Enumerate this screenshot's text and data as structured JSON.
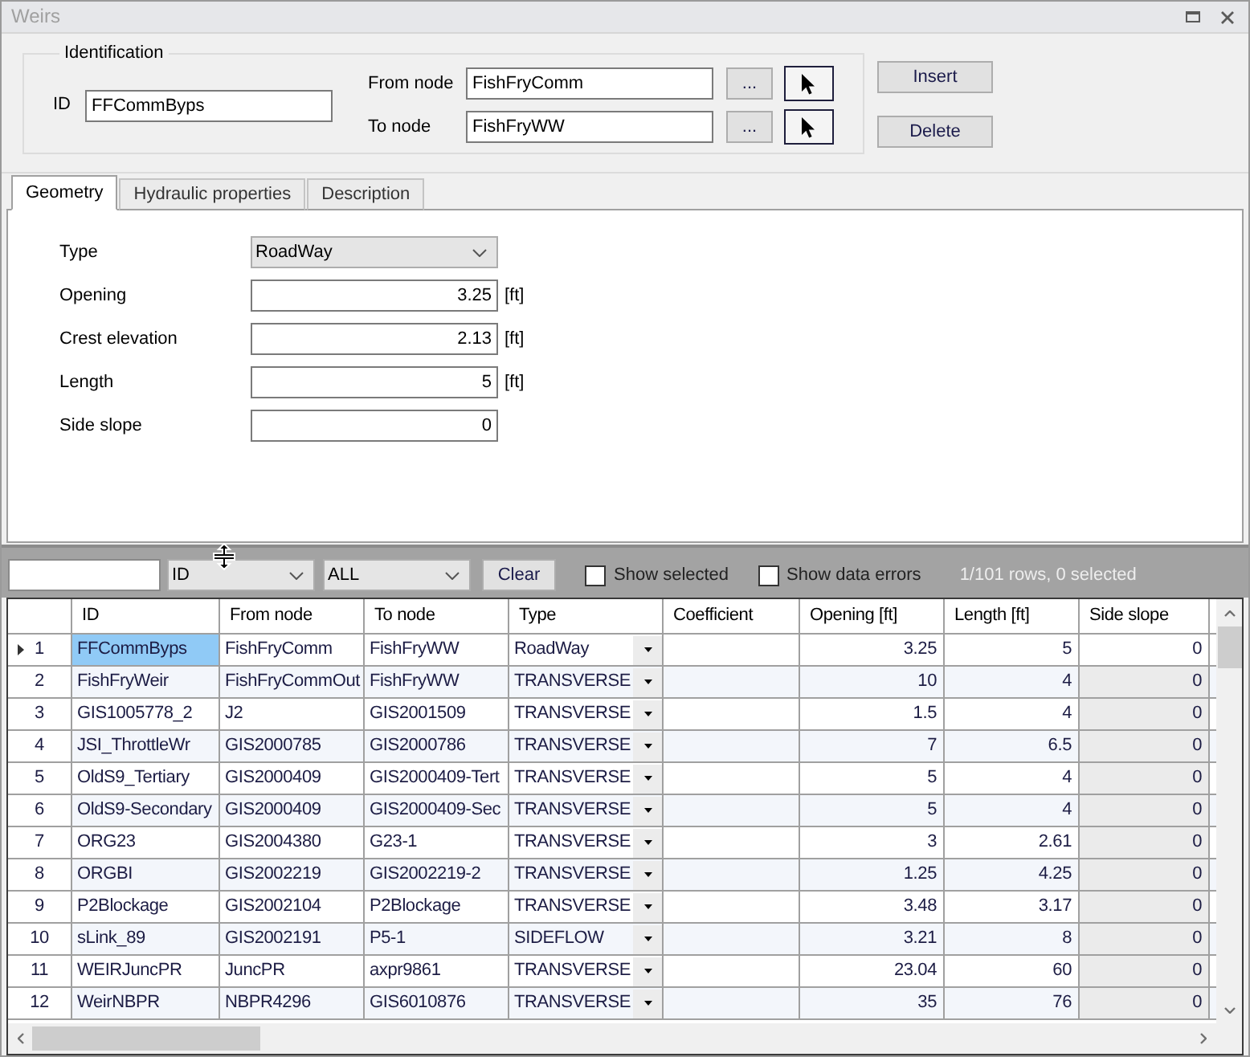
{
  "window": {
    "title": "Weirs"
  },
  "identification": {
    "title": "Identification",
    "id": {
      "label": "ID",
      "value": "FFCommByps"
    },
    "nodes": [
      {
        "label": "From node",
        "value": "FishFryComm",
        "browse": "..."
      },
      {
        "label": "To node",
        "value": "FishFryWW",
        "browse": "..."
      }
    ]
  },
  "actions": [
    "Insert",
    "Delete"
  ],
  "tabs": [
    {
      "label": "Geometry",
      "selected": true
    },
    {
      "label": "Hydraulic properties",
      "selected": false
    },
    {
      "label": "Description",
      "selected": false
    }
  ],
  "geometry": [
    {
      "kind": "select",
      "label": "Type",
      "value": "RoadWay"
    },
    {
      "kind": "number",
      "label": "Opening",
      "value": "3.25",
      "unit": "[ft]"
    },
    {
      "kind": "number",
      "label": "Crest elevation",
      "value": "2.13",
      "unit": "[ft]"
    },
    {
      "kind": "number",
      "label": "Length",
      "value": "5",
      "unit": "[ft]"
    },
    {
      "kind": "number",
      "label": "Side slope",
      "value": "0"
    }
  ],
  "filter_bar": {
    "column_filter": "ID",
    "mode_filter": "ALL",
    "clear": "Clear",
    "options": [
      {
        "label": "Show selected",
        "checked": false
      },
      {
        "label": "Show data errors",
        "checked": false
      }
    ],
    "status": "1/101 rows, 0 selected"
  },
  "table": {
    "columns": [
      {
        "label": "ID",
        "kind": "text",
        "readonly": false
      },
      {
        "label": "From node",
        "kind": "text",
        "readonly": false
      },
      {
        "label": "To node",
        "kind": "text",
        "readonly": false
      },
      {
        "label": "Type",
        "kind": "dropdown",
        "readonly": false
      },
      {
        "label": "Coefficient",
        "kind": "number",
        "readonly": false
      },
      {
        "label": "Opening [ft]",
        "kind": "number",
        "readonly": false
      },
      {
        "label": "Length [ft]",
        "kind": "number",
        "readonly": false
      },
      {
        "label": "Side slope",
        "kind": "number",
        "readonly": true
      }
    ],
    "rows": [
      {
        "number": "1",
        "current": true,
        "id": "FFCommByps",
        "from_node": "FishFryComm",
        "to_node": "FishFryWW",
        "type": "RoadWay",
        "opening": "3.25",
        "length": "5",
        "side_slope": "0"
      },
      {
        "number": "2",
        "current": false,
        "id": "FishFryWeir",
        "from_node": "FishFryCommOut",
        "to_node": "FishFryWW",
        "type": "TRANSVERSE",
        "opening": "10",
        "length": "4",
        "side_slope": "0"
      },
      {
        "number": "3",
        "current": false,
        "id": "GIS1005778_2",
        "from_node": "J2",
        "to_node": "GIS2001509",
        "type": "TRANSVERSE",
        "opening": "1.5",
        "length": "4",
        "side_slope": "0"
      },
      {
        "number": "4",
        "current": false,
        "id": "JSI_ThrottleWr",
        "from_node": "GIS2000785",
        "to_node": "GIS2000786",
        "type": "TRANSVERSE",
        "opening": "7",
        "length": "6.5",
        "side_slope": "0"
      },
      {
        "number": "5",
        "current": false,
        "id": "OldS9_Tertiary",
        "from_node": "GIS2000409",
        "to_node": "GIS2000409-Tert",
        "type": "TRANSVERSE",
        "opening": "5",
        "length": "4",
        "side_slope": "0"
      },
      {
        "number": "6",
        "current": false,
        "id": "OldS9-Secondary",
        "from_node": "GIS2000409",
        "to_node": "GIS2000409-Sec",
        "type": "TRANSVERSE",
        "opening": "5",
        "length": "4",
        "side_slope": "0"
      },
      {
        "number": "7",
        "current": false,
        "id": "ORG23",
        "from_node": "GIS2004380",
        "to_node": "G23-1",
        "type": "TRANSVERSE",
        "opening": "3",
        "length": "2.61",
        "side_slope": "0"
      },
      {
        "number": "8",
        "current": false,
        "id": "ORGBI",
        "from_node": "GIS2002219",
        "to_node": "GIS2002219-2",
        "type": "TRANSVERSE",
        "opening": "1.25",
        "length": "4.25",
        "side_slope": "0"
      },
      {
        "number": "9",
        "current": false,
        "id": "P2Blockage",
        "from_node": "GIS2002104",
        "to_node": "P2Blockage",
        "type": "TRANSVERSE",
        "opening": "3.48",
        "length": "3.17",
        "side_slope": "0"
      },
      {
        "number": "10",
        "current": false,
        "id": "sLink_89",
        "from_node": "GIS2002191",
        "to_node": "P5-1",
        "type": "SIDEFLOW",
        "opening": "3.21",
        "length": "8",
        "side_slope": "0"
      },
      {
        "number": "11",
        "current": false,
        "id": "WEIRJuncPR",
        "from_node": "JuncPR",
        "to_node": "axpr9861",
        "type": "TRANSVERSE",
        "opening": "23.04",
        "length": "60",
        "side_slope": "0"
      },
      {
        "number": "12",
        "current": false,
        "id": "WeirNBPR",
        "from_node": "NBPR4296",
        "to_node": "GIS6010876",
        "type": "TRANSVERSE",
        "opening": "35",
        "length": "76",
        "side_slope": "0"
      }
    ]
  }
}
